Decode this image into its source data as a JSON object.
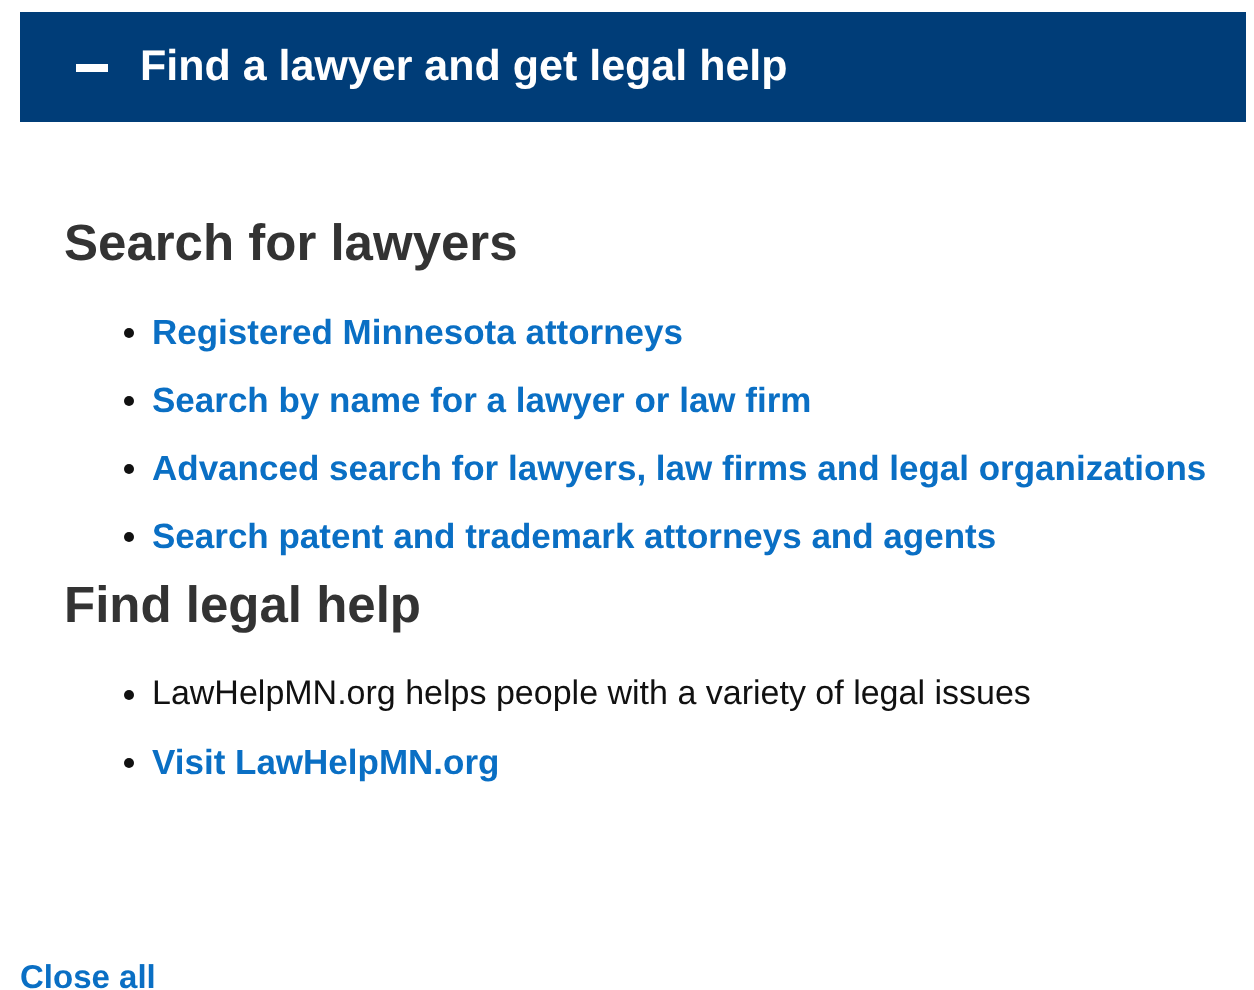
{
  "accordion": {
    "title": "Find a lawyer and get legal help",
    "expanded": true,
    "sections": [
      {
        "heading": "Search for lawyers",
        "items": [
          {
            "kind": "link",
            "text": "Registered Minnesota attorneys"
          },
          {
            "kind": "link",
            "text": "Search by name for a lawyer or law firm"
          },
          {
            "kind": "link",
            "text": "Advanced search for lawyers, law firms and legal organizations"
          },
          {
            "kind": "link",
            "text": "Search patent and trademark attorneys and agents"
          }
        ]
      },
      {
        "heading": "Find legal help",
        "items": [
          {
            "kind": "text",
            "text": "LawHelpMN.org helps people with a variety of legal issues"
          },
          {
            "kind": "link",
            "text": "Visit LawHelpMN.org"
          }
        ]
      }
    ]
  },
  "close_all": "Close all"
}
